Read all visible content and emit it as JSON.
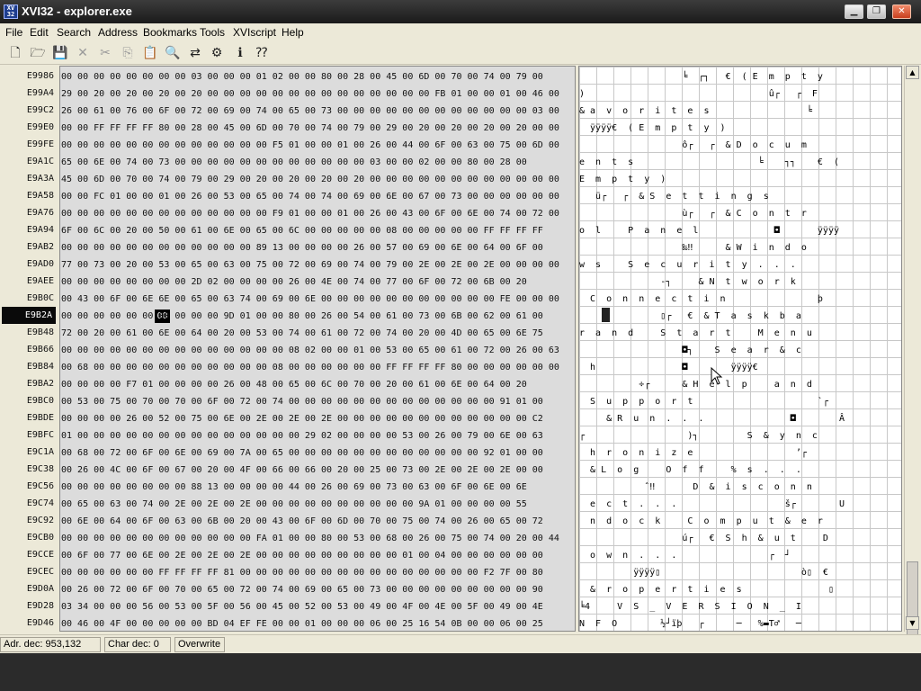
{
  "window": {
    "title": "XVI32 - explorer.exe",
    "icon": "xvi32-app-icon",
    "controls": {
      "minimize": "minimize-icon",
      "maximize": "maximize-icon",
      "close": "close-icon"
    }
  },
  "menu": [
    "File",
    "Edit",
    "Search",
    "Address",
    "Bookmarks",
    "Tools",
    "XVIscript",
    "Help"
  ],
  "toolbar": {
    "icons": [
      "new-file-icon",
      "open-folder-icon",
      "save-icon",
      "close-file-icon",
      "cut-icon",
      "copy-icon",
      "paste-icon",
      "find-icon",
      "replace-icon",
      "properties-icon",
      "script-icon",
      "help-context-icon"
    ],
    "disabled": [
      "close-file-icon",
      "cut-icon",
      "copy-icon"
    ]
  },
  "rows": [
    {
      "addr": "E9986",
      "hex": "00 00 00 00 00 00 00 00 03 00 00 00 01 02 00 00 80 00 28 00 45 00 6D 00 70 00 74 00 79 00",
      "chars": "                   ╘  ┌┐   €  ( E  m  p  t  y "
    },
    {
      "addr": "E99A4",
      "hex": "29 00 20 00 20 00 20 00 20 00 00 00 00 00 00 00 00 00 00 00 00 00 00 FB 01 00 00 01 00 46 00",
      "chars": ")                                  û┌   ┌  F"
    },
    {
      "addr": "E99C2",
      "hex": "26 00 61 00 76 00 6F 00 72 00 69 00 74 00 65 00 73 00 00 00 00 00 00 00 00 00 00 00 00 03 00",
      "chars": "& a  v  o  r  i  t  e  s                  ╘ "
    },
    {
      "addr": "E99E0",
      "hex": "00 00 FF FF FF FF 80 00 28 00 45 00 6D 00 70 00 74 00 79 00 29 00 20 00 20 00 20 00 20 00 00",
      "chars": "  ÿÿÿÿ€  ( E  m  p  t  y  )"
    },
    {
      "addr": "E99FE",
      "hex": "00 00 00 00 00 00 00 00 00 00 00 00 00 F5 01 00 00 01 00 26 00 44 00 6F 00 63 00 75 00 6D 00",
      "chars": "                   ô┌   ┌  & D  o  c  u  m"
    },
    {
      "addr": "E9A1C",
      "hex": "65 00 6E 00 74 00 73 00 00 00 00 00 00 00 00 00 00 00 00 03 00 00 02 00 00 80 00 28 00",
      "chars": "e  n  t  s                       ╘    ┐┐    €  ("
    },
    {
      "addr": "E9A3A",
      "hex": "45 00 6D 00 70 00 74 00 79 00 29 00 20 00 20 00 20 00 20 00 00 00 00 00 00 00 00 00 00 00 00",
      "chars": "E  m  p  t  y  )"
    },
    {
      "addr": "E9A58",
      "hex": "00 00 FC 01 00 00 01 00 26 00 53 00 65 00 74 00 74 00 69 00 6E 00 67 00 73 00 00 00 00 00 00",
      "chars": "   ü┌   ┌  & S  e  t  t  i  n  g  s"
    },
    {
      "addr": "E9A76",
      "hex": "00 00 00 00 00 00 00 00 00 00 00 00 00 F9 01 00 00 01 00 26 00 43 00 6F 00 6E 00 74 00 72 00",
      "chars": "                   ù┌   ┌  & C  o  n  t  r"
    },
    {
      "addr": "E9A94",
      "hex": "6F 00 6C 00 20 00 50 00 61 00 6E 00 65 00 6C 00 00 00 00 00 08 00 00 00 00 00 FF FF FF FF",
      "chars": "o  l     P  a  n  e  l              ◘       ÿÿÿÿ"
    },
    {
      "addr": "E9AB2",
      "hex": "00 00 00 00 00 00 00 00 00 00 00 00 89 13 00 00 00 00 26 00 57 00 69 00 6E 00 64 00 6F 00",
      "chars": "                   ‰‼      & W  i  n  d  o"
    },
    {
      "addr": "E9AD0",
      "hex": "77 00 73 00 20 00 53 00 65 00 63 00 75 00 72 00 69 00 74 00 79 00 2E 00 2E 00 2E 00 00 00 00",
      "chars": "w  s     S  e  c  u  r  i  t  y  .  .  ."
    },
    {
      "addr": "E9AEE",
      "hex": "00 00 00 00 00 00 00 00 2D 02 00 00 00 00 26 00 4E 00 74 00 77 00 6F 00 72 00 6B 00 20",
      "chars": "               -┐     & N  t  w  o  r  k"
    },
    {
      "addr": "E9B0C",
      "hex": "00 43 00 6F 00 6E 6E 00 65 00 63 74 00 69 00 6E 00 00 00 00 00 00 00 00 00 00 00 FE 00 00 00",
      "chars": "  C  o  n  n  e  c  t  i  n                 þ"
    },
    {
      "addr": "E9B2A",
      "hex": "00 00 00 00 00 00 00 00 00 00 9D 01 00 00 80 00 26 00 54 00 61 00 73 00 6B 00 62 00 61 00",
      "chars": "               ▯┌   €  & T  a  s  k  b  a",
      "selected": true
    },
    {
      "addr": "E9B48",
      "hex": "72 00 20 00 61 00 6E 00 64 00 20 00 53 00 74 00 61 00 72 00 74 00 20 00 4D 00 65 00 6E 75",
      "chars": "r  a  n  d     S  t  a  r  t     M  e  n  u"
    },
    {
      "addr": "E9B66",
      "hex": "00 00 00 00 00 00 00 00 00 00 00 00 00 00 08 02 00 00 01 00 53 00 65 00 61 00 72 00 26 00 63",
      "chars": "                   ◘┐    S  e  a  r  &  c"
    },
    {
      "addr": "E9B84",
      "hex": "00 68 00 00 00 00 00 00 00 00 00 00 00 08 00 00 00 00 00 00 FF FF FF FF 80 00 00 00 00 00 00",
      "chars": "  h                ◘        ÿÿÿÿ€"
    },
    {
      "addr": "E9BA2",
      "hex": "00 00 00 00 F7 01 00 00 00 00 26 00 48 00 65 00 6C 00 70 00 20 00 61 00 6E 00 64 00 20",
      "chars": "           ÷┌      & H  e  l  p     a  n  d"
    },
    {
      "addr": "E9BC0",
      "hex": "00 53 00 75 00 70 00 70 00 6F 00 72 00 74 00 00 00 00 00 00 00 00 00 00 00 00 00 91 01 00",
      "chars": "  S  u  p  p  o  r  t                       `┌"
    },
    {
      "addr": "E9BDE",
      "hex": "00 00 00 00 26 00 52 00 75 00 6E 00 2E 00 2E 00 2E 00 00 00 00 00 00 00 00 00 00 00 00 C2",
      "chars": "     & R  u  n  .  .  .                ◘        Â"
    },
    {
      "addr": "E9BFC",
      "hex": "01 00 00 00 00 00 00 00 00 00 00 00 00 00 00 29 02 00 00 00 00 53 00 26 00 79 00 6E 00 63",
      "chars": "┌                   )┐         S  &  y  n  c"
    },
    {
      "addr": "E9C1A",
      "hex": "00 68 00 72 00 6F 00 6E 00 69 00 7A 00 65 00 00 00 00 00 00 00 00 00 00 00 00 92 01 00 00",
      "chars": "  h  r  o  n  i  z  e                   ’┌"
    },
    {
      "addr": "E9C38",
      "hex": "00 26 00 4C 00 6F 00 67 00 20 00 4F 00 66 00 66 00 20 00 25 00 73 00 2E 00 2E 00 2E 00 00",
      "chars": "  & L  o  g     O  f  f     %  s  .  .  ."
    },
    {
      "addr": "E9C56",
      "hex": "00 00 00 00 00 00 00 00 88 13 00 00 00 00 44 00 26 00 69 00 73 00 63 00 6F 00 6E 00 6E",
      "chars": "            ˆ‼       D  &  i  s  c  o  n  n"
    },
    {
      "addr": "E9C74",
      "hex": "00 65 00 63 00 74 00 2E 00 2E 00 2E 00 00 00 00 00 00 00 00 00 00 9A 01 00 00 00 00 55",
      "chars": "  e  c  t  .  .  .                    š┌        U"
    },
    {
      "addr": "E9C92",
      "hex": "00 6E 00 64 00 6F 00 63 00 6B 00 20 00 43 00 6F 00 6D 00 70 00 75 00 74 00 26 00 65 00 72",
      "chars": "  n  d  o  c  k     C  o  m  p  u  t  &  e  r"
    },
    {
      "addr": "E9CB0",
      "hex": "00 00 00 00 00 00 00 00 00 00 00 00 FA 01 00 00 80 00 53 00 68 00 26 00 75 00 74 00 20 00 44",
      "chars": "                   ú┌   €  S  h  &  u  t     D"
    },
    {
      "addr": "E9CCE",
      "hex": "00 6F 00 77 00 6E 00 2E 00 2E 00 2E 00 00 00 00 00 00 00 00 00 01 00 04 00 00 00 00 00 00",
      "chars": "  o  w  n  .  .  .                 ┌  ┘"
    },
    {
      "addr": "E9CEC",
      "hex": "00 00 00 00 00 00 FF FF FF FF 81 00 00 00 00 00 00 00 00 00 00 00 00 00 00 00 F2 7F 00 80",
      "chars": "          ÿÿÿÿ▯                          ò▯  €"
    },
    {
      "addr": "E9D0A",
      "hex": "00 26 00 72 00 6F 00 70 00 65 00 72 00 74 00 69 00 65 00 73 00 00 00 00 00 00 00 00 00 90",
      "chars": "  &  r  o  p  e  r  t  i  e  s                ▯"
    },
    {
      "addr": "E9D28",
      "hex": "03 34 00 00 00 56 00 53 00 5F 00 56 00 45 00 52 00 53 00 49 00 4F 00 4E 00 5F 00 49 00 4E",
      "chars": "╘4     V  S  _  V  E  R  S  I  O  N  _  I"
    },
    {
      "addr": "E9D46",
      "hex": "00 46 00 4F 00 00 00 00 00 BD 04 EF FE 00 00 01 00 00 00 06 00 25 16 54 0B 00 00 06 00 25",
      "chars": "N  F  O        ½┘ïþ   ┌      ─   %▬T♂   ─"
    }
  ],
  "status": {
    "address": "Adr. dec: 953,132",
    "char": "Char dec: 0",
    "mode": "Overwrite"
  }
}
